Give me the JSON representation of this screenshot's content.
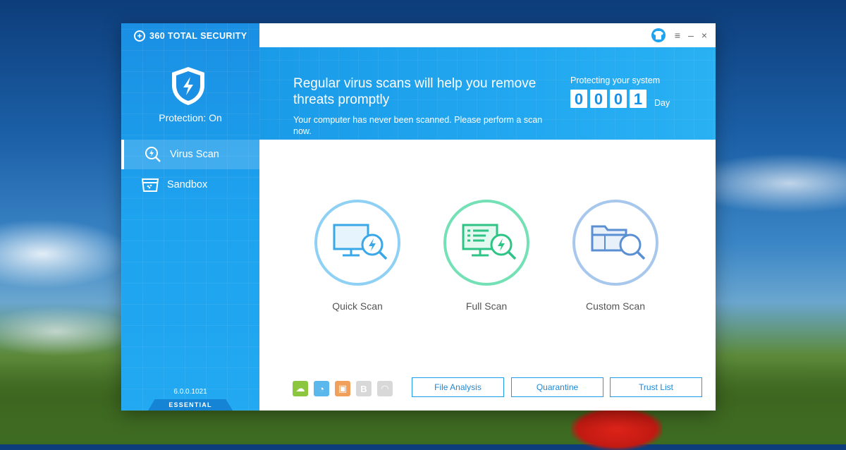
{
  "app": {
    "logo_text": "360 TOTAL SECURITY",
    "protection_status": "Protection: On",
    "version": "6.0.0.1021",
    "edition": "ESSENTIAL"
  },
  "sidebar": {
    "items": [
      {
        "label": "Virus Scan",
        "icon": "virus-scan-icon",
        "active": true
      },
      {
        "label": "Sandbox",
        "icon": "sandbox-icon",
        "active": false
      }
    ]
  },
  "titlebar": {
    "buttons": [
      "skin-icon",
      "menu-icon",
      "minimize-icon",
      "close-icon"
    ],
    "menu_glyph": "≡",
    "minimize_glyph": "–",
    "close_glyph": "×"
  },
  "banner": {
    "title": "Regular virus scans will help you remove threats promptly",
    "subtitle": "Your computer has never been scanned. Please perform a scan now.",
    "days_label": "Protecting your system",
    "digits": [
      "0",
      "0",
      "0",
      "1"
    ],
    "days_unit": "Day"
  },
  "scans": [
    {
      "label": "Quick Scan",
      "icon": "quick-scan-icon",
      "color": "#8fd1f5"
    },
    {
      "label": "Full Scan",
      "icon": "full-scan-icon",
      "color": "#74e0b5"
    },
    {
      "label": "Custom Scan",
      "icon": "custom-scan-icon",
      "color": "#a7c8ec"
    }
  ],
  "tools": [
    {
      "icon": "cloud-icon",
      "color": "#8cc63f",
      "glyph": "☁"
    },
    {
      "icon": "speed-icon",
      "color": "#5bb8ec",
      "glyph": "◔"
    },
    {
      "icon": "image-icon",
      "color": "#f0a05a",
      "glyph": "▣"
    },
    {
      "icon": "bold-b-icon",
      "color": "#d8d8d8",
      "glyph": "B"
    },
    {
      "icon": "gauge-icon",
      "color": "#d8d8d8",
      "glyph": "◠"
    }
  ],
  "bottom_buttons": {
    "file_analysis": "File Analysis",
    "quarantine": "Quarantine",
    "trust_list": "Trust List"
  },
  "colors": {
    "accent": "#1ea3ef",
    "sidebar": "#1a8fe3",
    "button_border": "#1e9cea"
  }
}
